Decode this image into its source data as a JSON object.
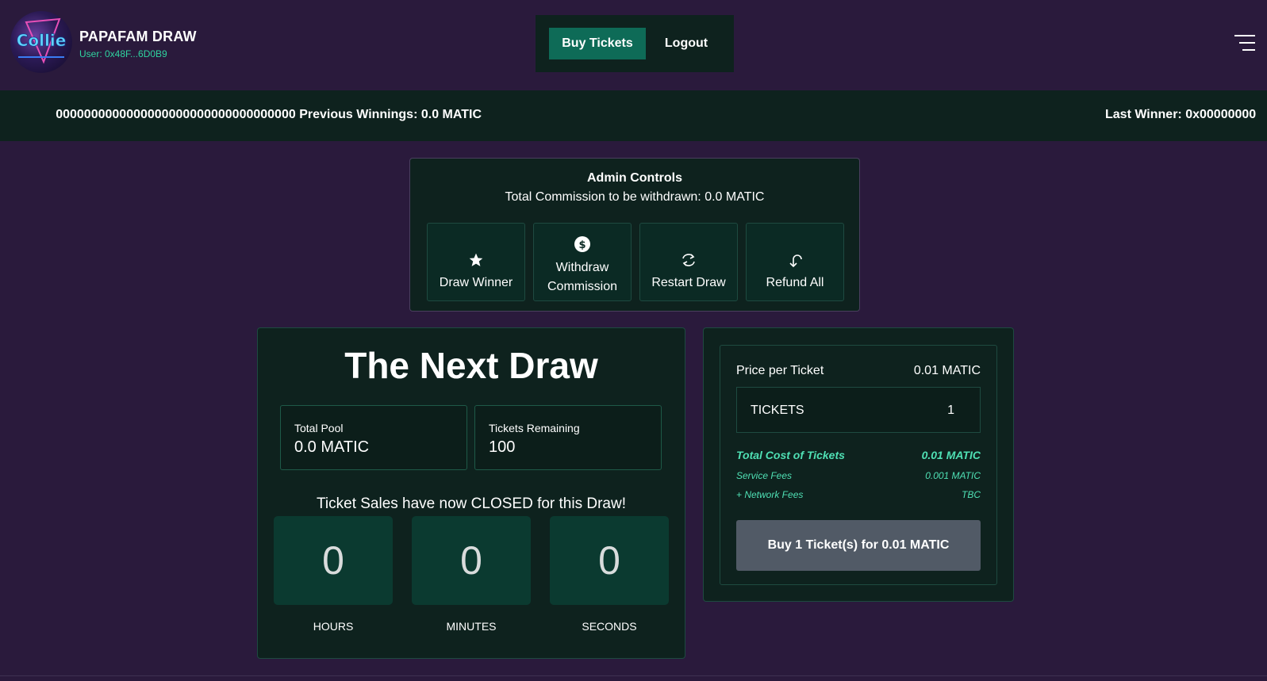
{
  "header": {
    "brand_title": "PAPAFAM DRAW",
    "user": "User: 0x48F...6D0B9",
    "logo_text": "Collie"
  },
  "nav": {
    "buy_label": "Buy Tickets",
    "logout_label": "Logout",
    "menu_icon": "hamburger-icon"
  },
  "ticker": {
    "segment_a": "0000000000000000000000000000000000  Previous Winnings: 0.0 MATIC",
    "segment_b": "Last Winner: 0x00000000"
  },
  "admin": {
    "title": "Admin Controls",
    "subtitle": "Total Commission to be withdrawn: 0.0 MATIC",
    "buttons": [
      {
        "label": "Draw Winner",
        "icon": "star-icon"
      },
      {
        "label_line1": "Withdraw",
        "label_line2": "Commission",
        "icon": "dollar-icon"
      },
      {
        "label": "Restart Draw",
        "icon": "refresh-icon"
      },
      {
        "label": "Refund All",
        "icon": "undo-icon"
      }
    ]
  },
  "draw": {
    "title": "The Next Draw",
    "total_pool_label": "Total Pool",
    "total_pool_value": "0.0 MATIC",
    "tickets_remaining_label": "Tickets Remaining",
    "tickets_remaining_value": "100",
    "closed_message": "Ticket Sales have now CLOSED for this Draw!",
    "countdown": [
      {
        "value": "0",
        "label": "HOURS"
      },
      {
        "value": "0",
        "label": "MINUTES"
      },
      {
        "value": "0",
        "label": "SECONDS"
      }
    ]
  },
  "purchase": {
    "price_label": "Price per Ticket",
    "price_value": "0.01 MATIC",
    "tickets_label": "TICKETS",
    "tickets_value": "1",
    "total_label": "Total Cost of Tickets",
    "total_value": "0.01 MATIC",
    "service_label": "Service Fees",
    "service_value": "0.001 MATIC",
    "network_label": "+ Network Fees",
    "network_value": "TBC",
    "button_label": "Buy 1 Ticket(s) for 0.01 MATIC"
  },
  "colors": {
    "background": "#2a1a3c",
    "panel": "#0e221e",
    "accent": "#0e6b57",
    "highlight": "#4fe0b4",
    "disabled_button": "#515a66"
  }
}
